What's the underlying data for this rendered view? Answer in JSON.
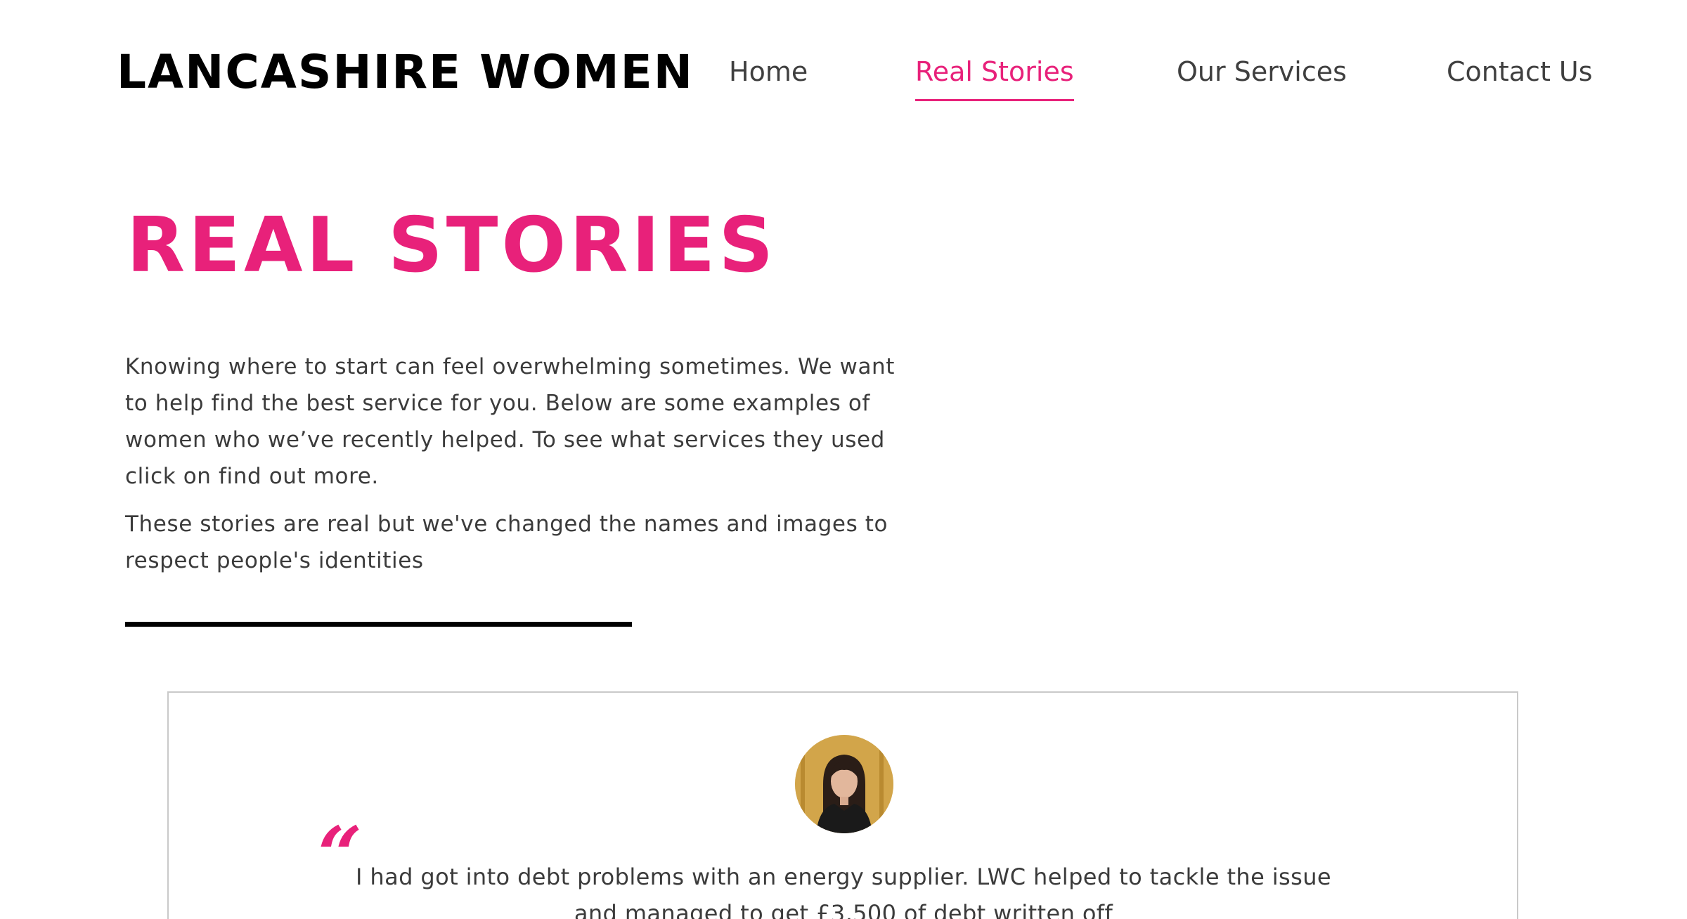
{
  "header": {
    "logo_text": "LANCASHIRE WOMEN"
  },
  "nav": {
    "items": [
      {
        "label": "Home",
        "active": false
      },
      {
        "label": "Real Stories",
        "active": true
      },
      {
        "label": "Our Services",
        "active": false
      },
      {
        "label": "Contact Us",
        "active": false
      }
    ]
  },
  "hero": {
    "title": "REAL STORIES",
    "paragraph_1": "Knowing where to start can feel overwhelming sometimes. We want to help find the best service for you. Below are some examples of women who we’ve recently helped. To see what services they used click on find out more.",
    "paragraph_2": "These stories are real but we've changed the names and images to respect people's identities"
  },
  "story": {
    "quote_mark": "“",
    "quote": "I had got into debt problems with an energy supplier. LWC helped to tackle the issue and managed to get £3,500 of debt written off"
  },
  "colors": {
    "accent": "#e8217a",
    "text": "#3b3b3b",
    "logo": "#000000",
    "card_border": "#c9c9c9"
  }
}
